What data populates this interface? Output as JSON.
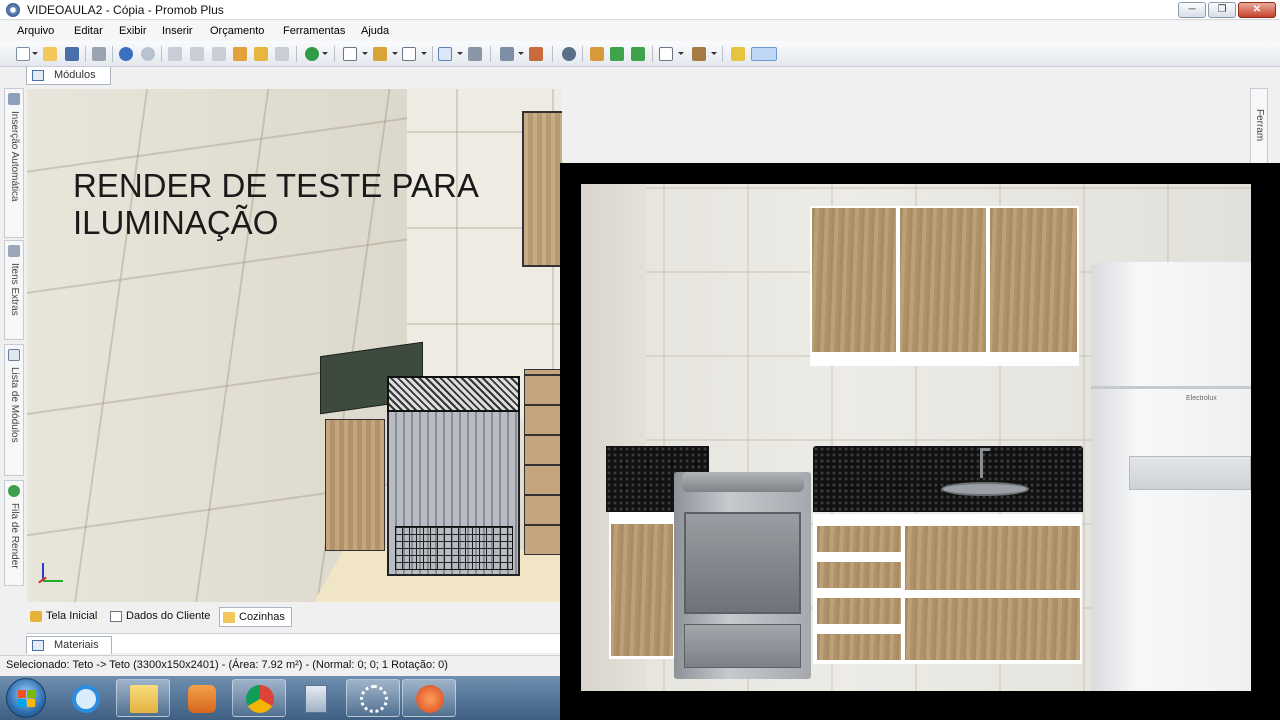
{
  "window": {
    "title": "VIDEOAULA2 - Cópia - Promob Plus",
    "controls": {
      "minimize": "─",
      "maximize": "❐",
      "close": "✕"
    }
  },
  "menu": [
    "Arquivo",
    "Editar",
    "Exibir",
    "Inserir",
    "Orçamento",
    "Ferramentas",
    "Ajuda"
  ],
  "panels": {
    "top_tab": "Módulos",
    "bottom_tab": "Materiais"
  },
  "left_sidebar": [
    "Inserção Automática",
    "Itens Extras",
    "Lista de Módulos",
    "Fila de Render"
  ],
  "right_sidebar": [
    "Ferram"
  ],
  "viewport": {
    "overlay_text_line1": "RENDER DE TESTE PARA",
    "overlay_text_line2": "ILUMINAÇÃO"
  },
  "scene_tabs": [
    {
      "label": "Tela Inicial",
      "active": false
    },
    {
      "label": "Dados do Cliente",
      "active": false
    },
    {
      "label": "Cozinhas",
      "active": true
    }
  ],
  "status": {
    "text": "Selecionado: Teto -> Teto (3300x150x2401) - (Área: 7.92 m²) - (Normal: 0; 0; 1 Rotação: 0)"
  },
  "render": {
    "fridge_brand": "Electrolux"
  },
  "colors": {
    "wood": "#b09268",
    "granite": "#1d1d1d",
    "taskbar": "#4e6f92"
  },
  "taskbar_icons": [
    "start-orb-icon",
    "internet-explorer-icon",
    "file-explorer-icon",
    "media-player-icon",
    "chrome-icon",
    "calculator-icon",
    "network-icon",
    "app-icon"
  ]
}
